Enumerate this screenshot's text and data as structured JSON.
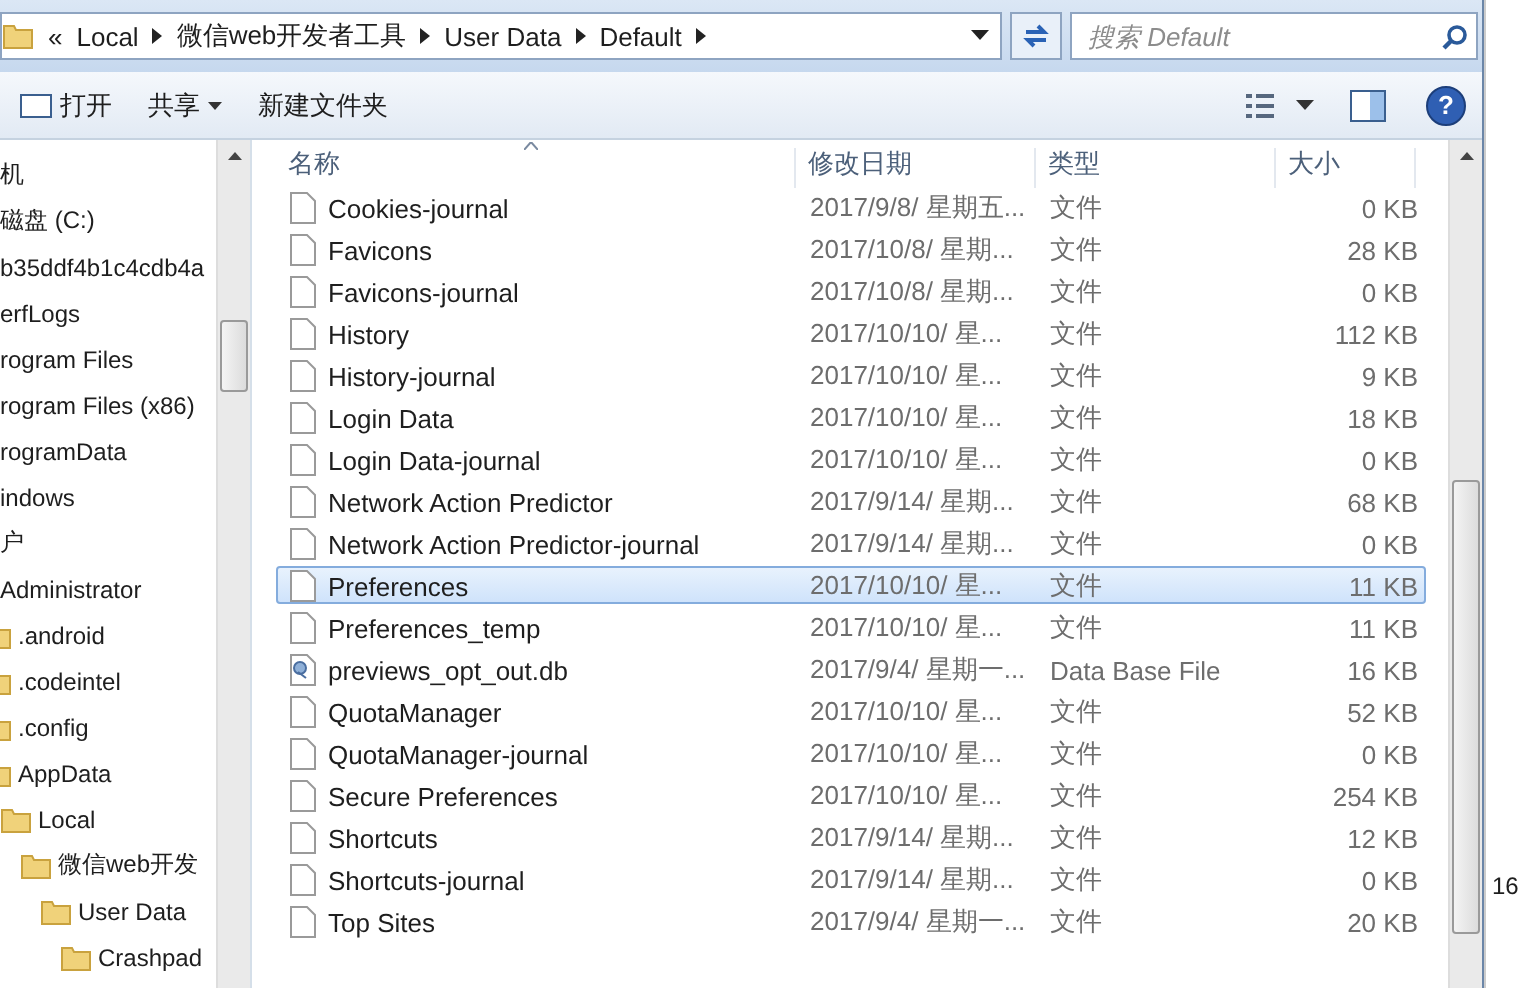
{
  "address_bar": {
    "crumbs": [
      "«",
      "Local",
      "微信web开发者工具",
      "User Data",
      "Default"
    ],
    "search": {
      "placeholder": "搜索 Default"
    }
  },
  "toolbar": {
    "open": "打开",
    "share": "共享",
    "new_folder": "新建文件夹",
    "help": "?"
  },
  "nav": [
    {
      "label": "机"
    },
    {
      "label": "磁盘 (C:)"
    },
    {
      "label": "b35ddf4b1c4cdb4a"
    },
    {
      "label": "erfLogs"
    },
    {
      "label": "rogram Files"
    },
    {
      "label": "rogram Files (x86)"
    },
    {
      "label": "rogramData"
    },
    {
      "label": "indows"
    },
    {
      "label": "户",
      "children": [
        {
          "label": "Administrator",
          "children": [
            {
              "label": ".android",
              "kind": "folder"
            },
            {
              "label": ".codeintel",
              "kind": "folder"
            },
            {
              "label": ".config",
              "kind": "folder"
            },
            {
              "label": "AppData",
              "kind": "folder",
              "children": [
                {
                  "label": "Local",
                  "kind": "folder",
                  "children": [
                    {
                      "label": "微信web开发",
                      "kind": "folder",
                      "children": [
                        {
                          "label": "User Data",
                          "kind": "folder",
                          "children": [
                            {
                              "label": "Crashpad",
                              "kind": "folder"
                            }
                          ]
                        }
                      ]
                    }
                  ]
                }
              ]
            }
          ]
        }
      ]
    }
  ],
  "table": {
    "columns": [
      "名称",
      "修改日期",
      "类型",
      "大小"
    ],
    "rows": [
      {
        "name": "Cookies-journal",
        "date": "2017/9/8/ 星期五...",
        "type": "文件",
        "size": "0 KB",
        "kind": "file",
        "selected": false
      },
      {
        "name": "Favicons",
        "date": "2017/10/8/ 星期...",
        "type": "文件",
        "size": "28 KB",
        "kind": "file",
        "selected": false
      },
      {
        "name": "Favicons-journal",
        "date": "2017/10/8/ 星期...",
        "type": "文件",
        "size": "0 KB",
        "kind": "file",
        "selected": false
      },
      {
        "name": "History",
        "date": "2017/10/10/ 星...",
        "type": "文件",
        "size": "112 KB",
        "kind": "file",
        "selected": false
      },
      {
        "name": "History-journal",
        "date": "2017/10/10/ 星...",
        "type": "文件",
        "size": "9 KB",
        "kind": "file",
        "selected": false
      },
      {
        "name": "Login Data",
        "date": "2017/10/10/ 星...",
        "type": "文件",
        "size": "18 KB",
        "kind": "file",
        "selected": false
      },
      {
        "name": "Login Data-journal",
        "date": "2017/10/10/ 星...",
        "type": "文件",
        "size": "0 KB",
        "kind": "file",
        "selected": false
      },
      {
        "name": "Network Action Predictor",
        "date": "2017/9/14/ 星期...",
        "type": "文件",
        "size": "68 KB",
        "kind": "file",
        "selected": false
      },
      {
        "name": "Network Action Predictor-journal",
        "date": "2017/9/14/ 星期...",
        "type": "文件",
        "size": "0 KB",
        "kind": "file",
        "selected": false
      },
      {
        "name": "Preferences",
        "date": "2017/10/10/ 星...",
        "type": "文件",
        "size": "11 KB",
        "kind": "file",
        "selected": true
      },
      {
        "name": "Preferences_temp",
        "date": "2017/10/10/ 星...",
        "type": "文件",
        "size": "11 KB",
        "kind": "file",
        "selected": false
      },
      {
        "name": "previews_opt_out.db",
        "date": "2017/9/4/ 星期一...",
        "type": "Data Base File",
        "size": "16 KB",
        "kind": "database",
        "selected": false
      },
      {
        "name": "QuotaManager",
        "date": "2017/10/10/ 星...",
        "type": "文件",
        "size": "52 KB",
        "kind": "file",
        "selected": false
      },
      {
        "name": "QuotaManager-journal",
        "date": "2017/10/10/ 星...",
        "type": "文件",
        "size": "0 KB",
        "kind": "file",
        "selected": false
      },
      {
        "name": "Secure Preferences",
        "date": "2017/10/10/ 星...",
        "type": "文件",
        "size": "254 KB",
        "kind": "file",
        "selected": false
      },
      {
        "name": "Shortcuts",
        "date": "2017/9/14/ 星期...",
        "type": "文件",
        "size": "12 KB",
        "kind": "file",
        "selected": false
      },
      {
        "name": "Shortcuts-journal",
        "date": "2017/9/14/ 星期...",
        "type": "文件",
        "size": "0 KB",
        "kind": "file",
        "selected": false
      },
      {
        "name": "Top Sites",
        "date": "2017/9/4/ 星期一...",
        "type": "文件",
        "size": "20 KB",
        "kind": "file",
        "selected": false
      }
    ]
  },
  "background_window": {
    "text": "16"
  }
}
